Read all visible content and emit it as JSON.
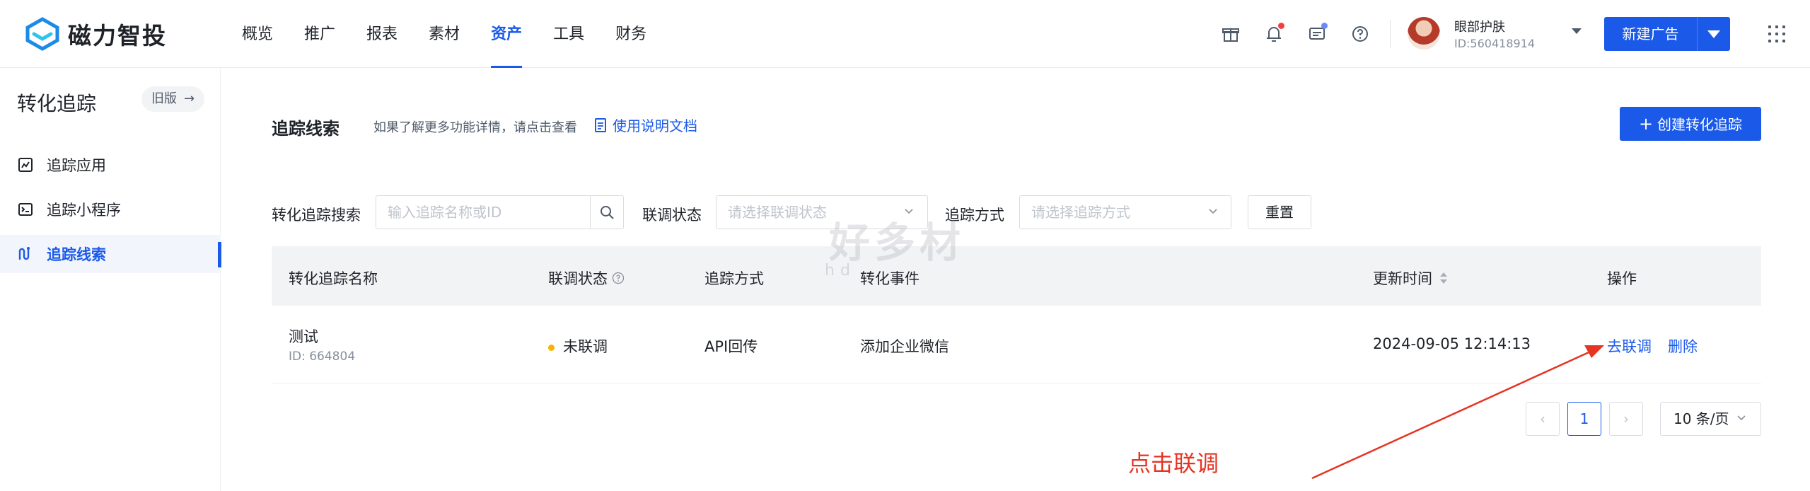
{
  "app": {
    "name": "磁力智投",
    "brand_color": "#1b5ae8"
  },
  "nav": {
    "items": [
      {
        "label": "概览"
      },
      {
        "label": "推广"
      },
      {
        "label": "报表"
      },
      {
        "label": "素材"
      },
      {
        "label": "资产",
        "active": true
      },
      {
        "label": "工具"
      },
      {
        "label": "财务"
      }
    ]
  },
  "header_icons": [
    "gift-icon",
    "bell-icon",
    "message-icon",
    "help-icon"
  ],
  "notification_colors": {
    "bell_dot": "#f53f3f",
    "message_dot": "#6b8af7"
  },
  "user": {
    "name": "眼部护肤",
    "id": "ID:560418914"
  },
  "new_ad_button": {
    "label": "新建广告"
  },
  "sidebar": {
    "title": "转化追踪",
    "old_version": "旧版",
    "items": [
      {
        "label": "追踪应用",
        "icon": "app-tracking-icon"
      },
      {
        "label": "追踪小程序",
        "icon": "miniprogram-icon"
      },
      {
        "label": "追踪线索",
        "icon": "lead-tracking-icon",
        "active": true
      }
    ]
  },
  "content": {
    "title": "追踪线索",
    "hint": "如果了解更多功能详情，请点击查看",
    "doc_link": "使用说明文档",
    "create_button": "创建转化追踪"
  },
  "filters": {
    "search_label": "转化追踪搜索",
    "search_placeholder": "输入追踪名称或ID",
    "status_label": "联调状态",
    "status_placeholder": "请选择联调状态",
    "method_label": "追踪方式",
    "method_placeholder": "请选择追踪方式",
    "reset_button": "重置"
  },
  "table": {
    "columns": [
      "转化追踪名称",
      "联调状态",
      "追踪方式",
      "转化事件",
      "更新时间",
      "操作"
    ],
    "rows": [
      {
        "name": "测试",
        "id": "ID: 664804",
        "status": "未联调",
        "method": "API回传",
        "event": "添加企业微信",
        "updated": "2024-09-05 12:14:13",
        "actions": [
          "去联调",
          "删除"
        ]
      }
    ]
  },
  "pagination": {
    "current_page": "1",
    "page_size": "10 条/页"
  },
  "annotation": {
    "text": "点击联调",
    "color": "#e53423"
  },
  "watermark": {
    "text": "好多材",
    "sub": "hd"
  }
}
